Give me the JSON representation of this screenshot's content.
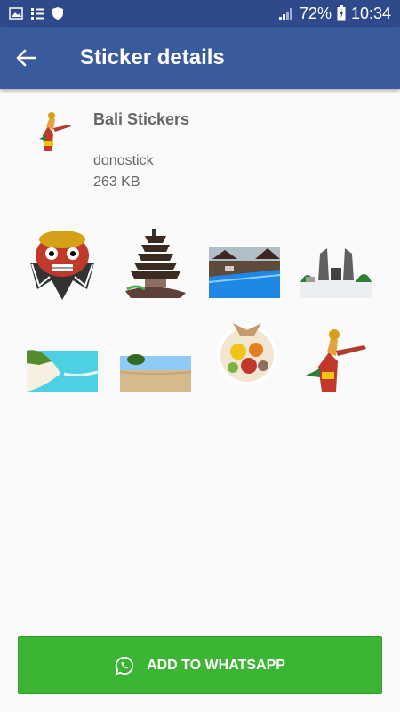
{
  "status_bar": {
    "battery": "72%",
    "time": "10:34"
  },
  "app_bar": {
    "title": "Sticker details"
  },
  "pack": {
    "name": "Bali Stickers",
    "author": "donostick",
    "size": "263 KB"
  },
  "stickers": [
    {
      "name": "barong-mask"
    },
    {
      "name": "temple-pagoda"
    },
    {
      "name": "resort-pool"
    },
    {
      "name": "temple-gate"
    },
    {
      "name": "beach-coast"
    },
    {
      "name": "beach-rock"
    },
    {
      "name": "food-platter"
    },
    {
      "name": "balinese-dancer"
    }
  ],
  "action": {
    "label": "ADD TO WHATSAPP"
  },
  "colors": {
    "status_bar": "#2f4a8a",
    "app_bar": "#3a5a9e",
    "button": "#3cb534"
  }
}
